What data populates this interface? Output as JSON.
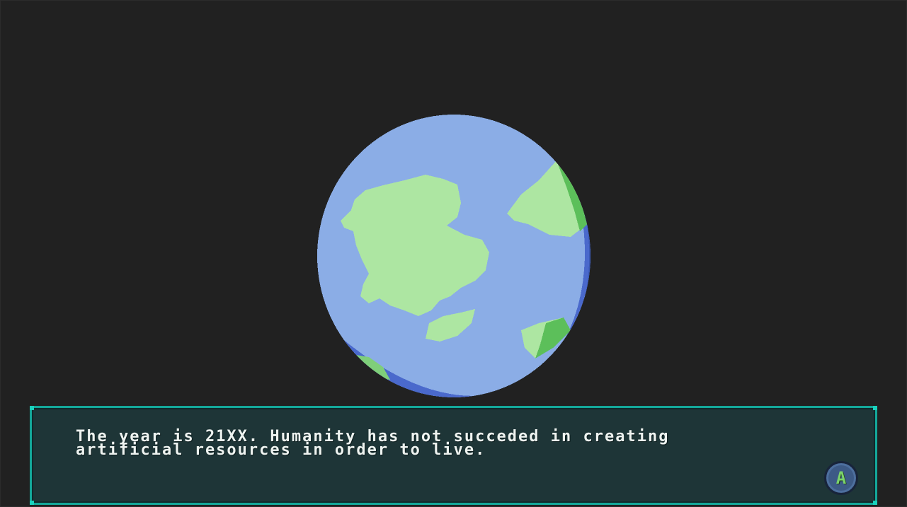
{
  "scene": {
    "background_color": "#212121"
  },
  "planet": {
    "icon": "earth-globe-icon",
    "ocean_light": "#8bade6",
    "ocean_dark": "#4a69cc",
    "land_light": "#ade6a2",
    "land_dark": "#5cbf5a"
  },
  "dialog": {
    "text": "The year is 21XX. Humanity has not succeded in creating\nartificial resources in order to live.",
    "border_color": "#14a89a",
    "background_color": "#1e3537",
    "advance_button_label": "A"
  }
}
